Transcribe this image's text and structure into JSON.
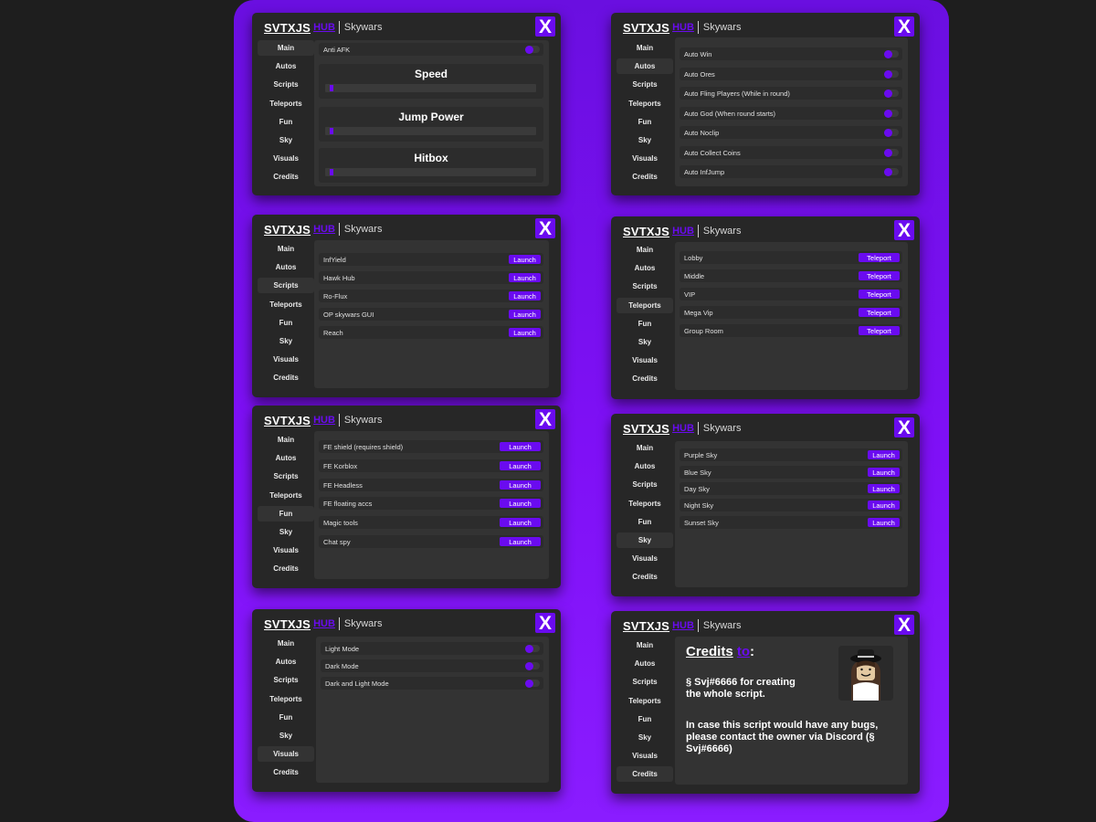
{
  "window_common": {
    "brand": "SVTXJS",
    "hub": "HUB",
    "game": "Skywars",
    "close_label": "X",
    "nav": [
      "Main",
      "Autos",
      "Scripts",
      "Teleports",
      "Fun",
      "Sky",
      "Visuals",
      "Credits"
    ]
  },
  "colors": {
    "accent": "#6a0bf0",
    "window_bg": "#272727",
    "panel_bg": "#333333",
    "stage_bg": "#7a10f0",
    "page_bg": "#1e1e1e"
  },
  "main_tab": {
    "anti_afk": "Anti AFK",
    "anti_afk_on": true,
    "sliders": [
      {
        "label": "Speed",
        "value": 0
      },
      {
        "label": "Jump Power",
        "value": 0
      },
      {
        "label": "Hitbox",
        "value": 0
      }
    ]
  },
  "autos_tab": {
    "items": [
      "Auto Win",
      "Auto Ores",
      "Auto Fling Players (While in round)",
      "Auto God (When round starts)",
      "Auto Noclip",
      "Auto Collect Coins",
      "Auto InfJump"
    ]
  },
  "scripts_tab": {
    "button_label": "Launch",
    "items": [
      "InfYield",
      "Hawk Hub",
      "Ro-Flux",
      "OP skywars GUI",
      "Reach"
    ]
  },
  "teleports_tab": {
    "button_label": "Teleport",
    "items": [
      "Lobby",
      "Middle",
      "VIP",
      "Mega Vip",
      "Group Room"
    ]
  },
  "fun_tab": {
    "button_label": "Launch",
    "items": [
      "FE shield (requires shield)",
      "FE Korblox",
      "FE Headless",
      "FE floating accs",
      "Magic tools",
      "Chat spy"
    ]
  },
  "sky_tab": {
    "button_label": "Launch",
    "items": [
      "Purple Sky",
      "Blue Sky",
      "Day Sky",
      "Night Sky",
      "Sunset Sky"
    ]
  },
  "visuals_tab": {
    "items": [
      "Light Mode",
      "Dark Mode",
      "Dark and Light Mode"
    ]
  },
  "credits_tab": {
    "title": "Credits",
    "title_to": "to",
    "title_colon": ":",
    "line1": "§ Svj#6666 for creating\nthe whole script.",
    "line2": "In case this script would have any bugs,\nplease contact the owner via Discord (§\nSvj#6666)"
  }
}
